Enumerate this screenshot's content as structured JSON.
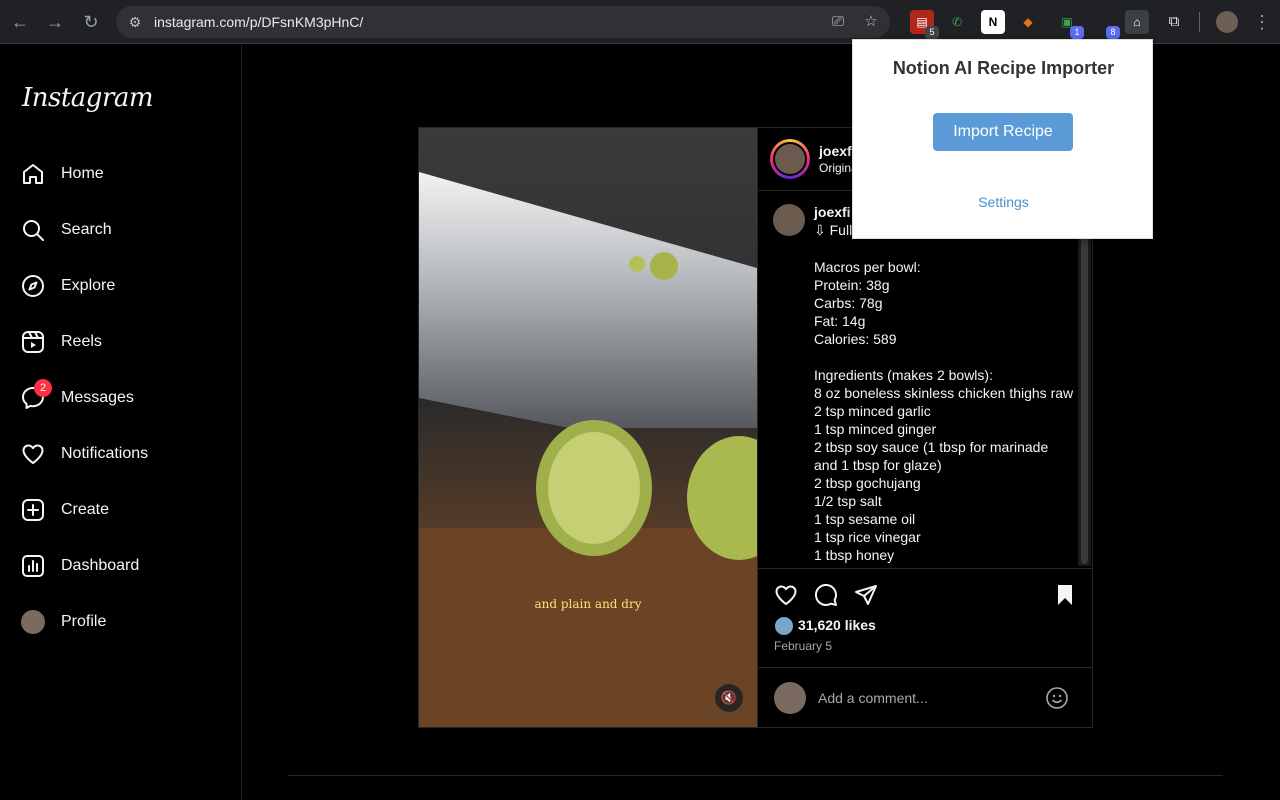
{
  "browser": {
    "url": "instagram.com/p/DFsnKM3pHnC/",
    "extension_badges": [
      "5",
      "1",
      "8"
    ]
  },
  "sidebar": {
    "logo": "Instagram",
    "items": [
      {
        "label": "Home",
        "icon": "home-icon"
      },
      {
        "label": "Search",
        "icon": "search-icon"
      },
      {
        "label": "Explore",
        "icon": "compass-icon"
      },
      {
        "label": "Reels",
        "icon": "reels-icon"
      },
      {
        "label": "Messages",
        "icon": "messenger-icon",
        "badge": "2"
      },
      {
        "label": "Notifications",
        "icon": "heart-icon"
      },
      {
        "label": "Create",
        "icon": "plus-square-icon"
      },
      {
        "label": "Dashboard",
        "icon": "chart-icon"
      },
      {
        "label": "Profile",
        "icon": "avatar"
      }
    ]
  },
  "post": {
    "video_caption": "and plain and dry",
    "header_user": "joexfi",
    "header_sub": "Origina",
    "comment_user": "joexfi",
    "comment_first": "⇩ Full",
    "comment_body": "Macros per bowl:\nProtein: 38g\nCarbs: 78g\nFat: 14g\nCalories: 589\n\nIngredients (makes 2 bowls):\n8 oz boneless skinless chicken thighs raw\n2 tsp minced garlic\n1 tsp minced ginger\n2 tbsp soy sauce (1 tbsp for marinade and 1 tbsp for glaze)\n2 tbsp gochujang\n1/2 tsp salt\n1 tsp sesame oil\n1 tsp rice vinegar\n1 tbsp honey",
    "likes": "31,620 likes",
    "date": "February 5",
    "comment_placeholder": "Add a comment..."
  },
  "popup": {
    "title": "Notion AI Recipe Importer",
    "import_label": "Import Recipe",
    "settings_label": "Settings"
  },
  "colors": {
    "accent": "#5a9ad6",
    "badge_red": "#ff3040"
  }
}
